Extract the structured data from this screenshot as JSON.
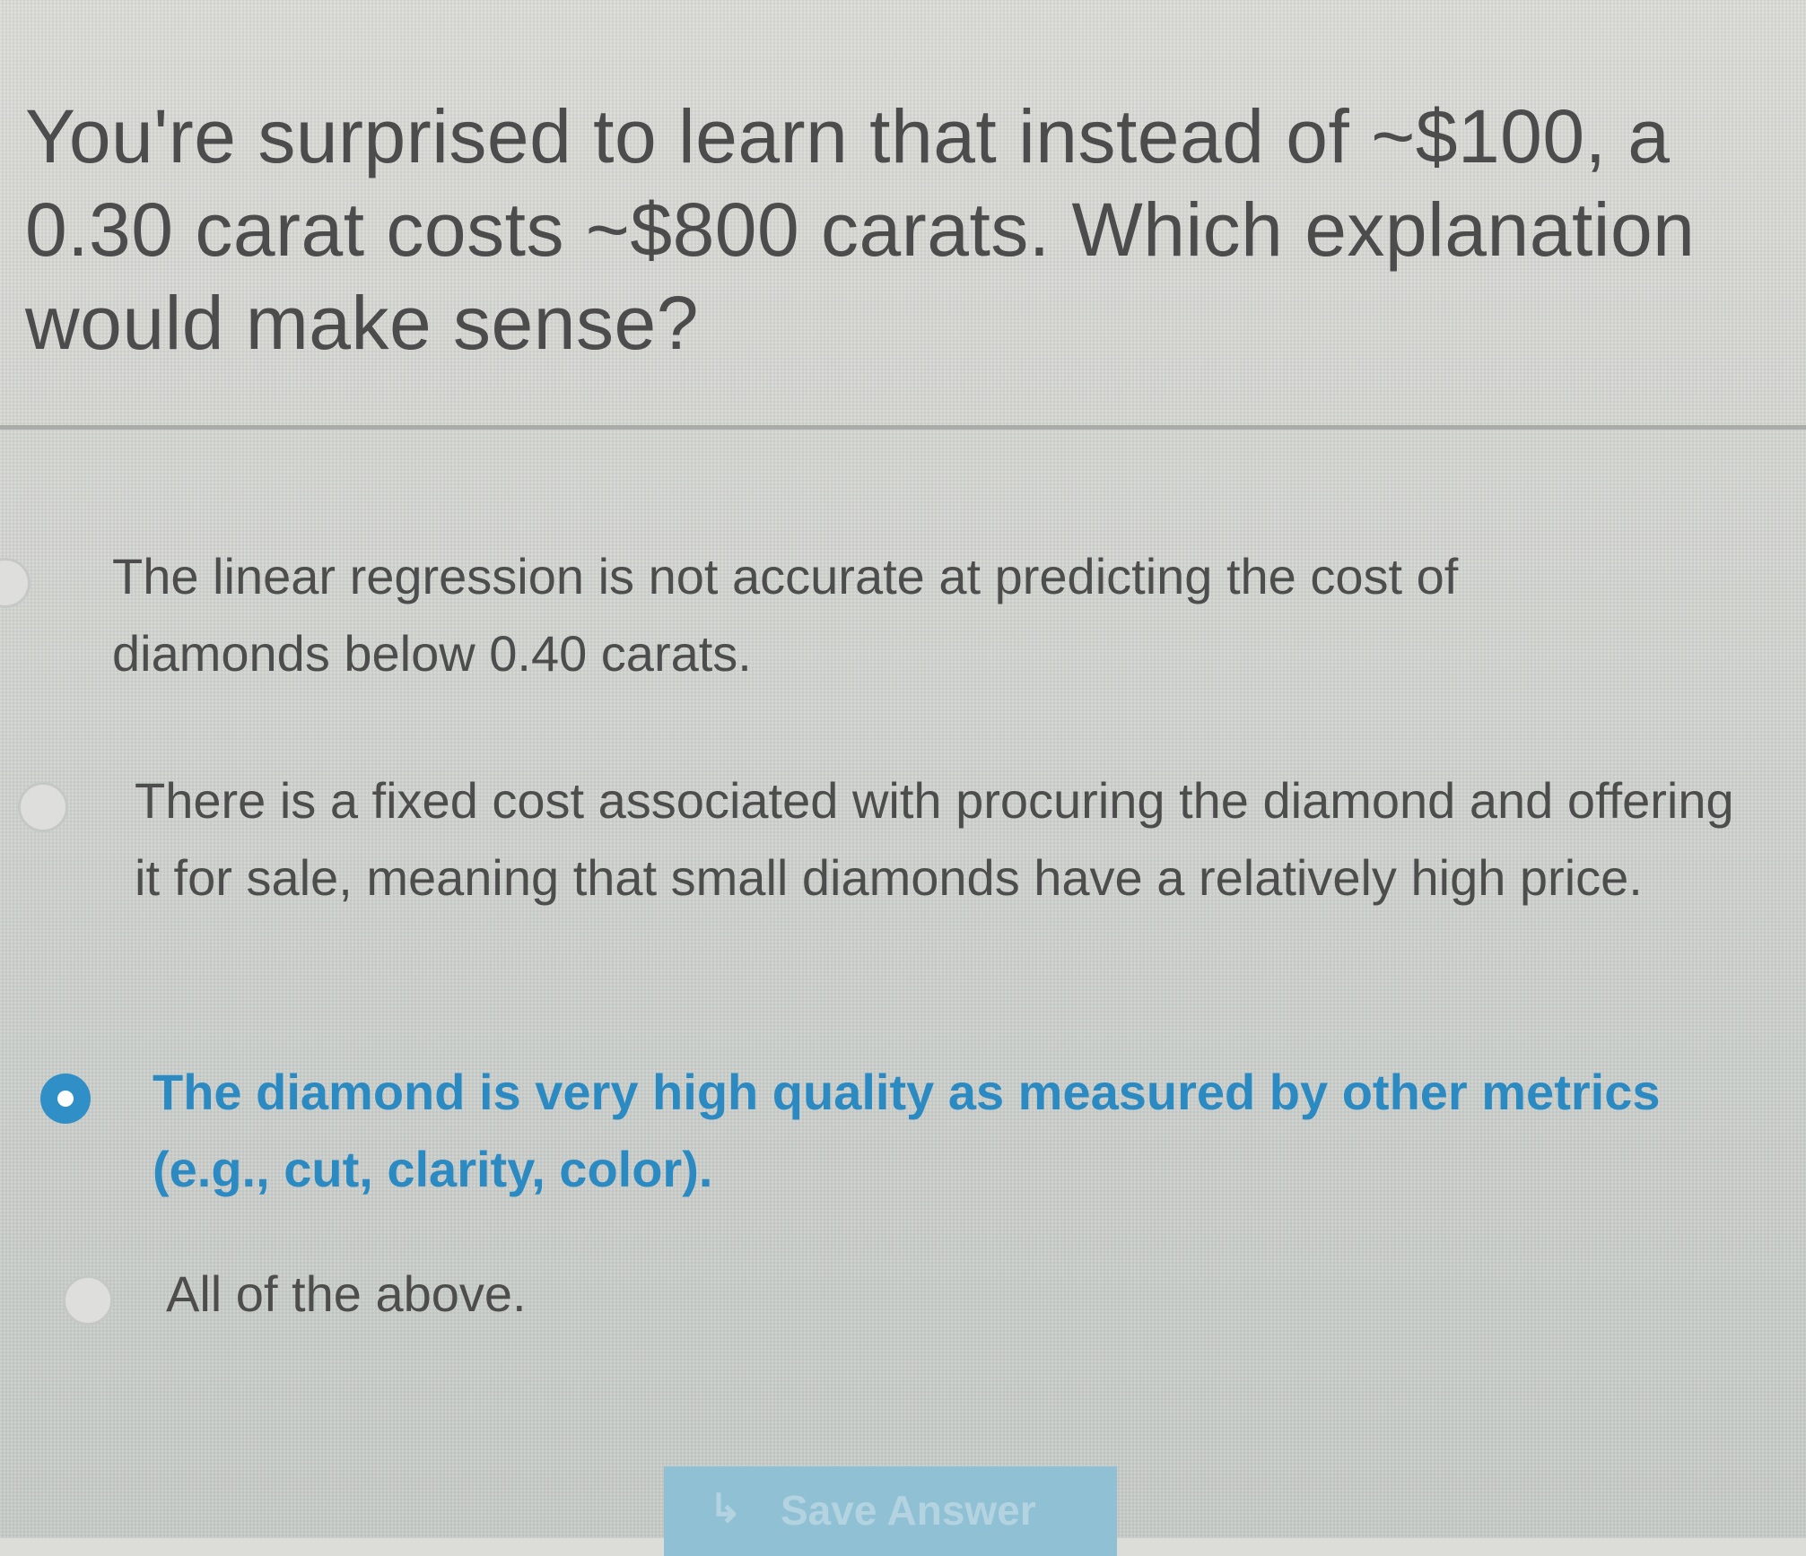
{
  "question": {
    "text": "You're surprised to learn that instead of ~$100, a 0.30 carat costs ~$800 carats. Which explanation would make sense?"
  },
  "options": [
    {
      "text": "The linear regression is not accurate at predicting the cost of diamonds below 0.40 carats.",
      "selected": false
    },
    {
      "text": "There is a fixed cost associated with procuring the diamond and offering it for sale, meaning that small diamonds have a relatively high price.",
      "selected": false
    },
    {
      "text": "The diamond is very high quality as measured by other metrics (e.g., cut, clarity, color).",
      "selected": true
    },
    {
      "text": "All of the above.",
      "selected": false
    }
  ],
  "save_button": {
    "label": "Save Answer",
    "icon": "reply-arrow-icon"
  },
  "colors": {
    "accent": "#2c8ac3",
    "background": "#d4d6d2",
    "text": "#4c4c4c",
    "button": "#8fc0d4"
  }
}
